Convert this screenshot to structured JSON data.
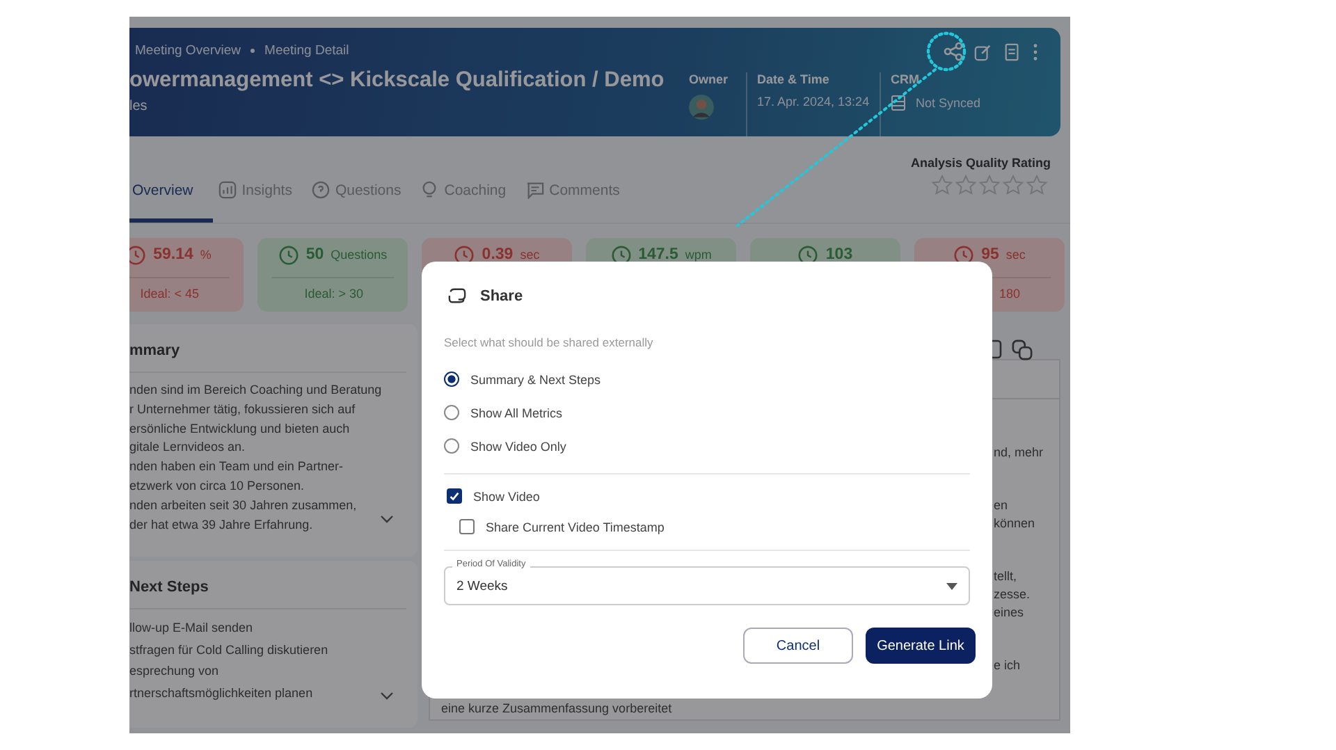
{
  "header": {
    "breadcrumb": [
      "Meeting Overview",
      "Meeting Detail"
    ],
    "title": "owermanagement <> Kickscale Qualification / Demo",
    "subtitle": "les",
    "owner_label": "Owner",
    "date_label": "Date & Time",
    "date": "17. Apr. 2024, 13:24",
    "crm_label": "CRM",
    "crm_status": "Not Synced"
  },
  "tabs": [
    {
      "label": "Overview",
      "selected": true
    },
    {
      "label": "Insights",
      "selected": false
    },
    {
      "label": "Questions",
      "selected": false
    },
    {
      "label": "Coaching",
      "selected": false
    },
    {
      "label": "Comments",
      "selected": false
    }
  ],
  "rating": {
    "label": "Analysis Quality Rating",
    "stars": 0
  },
  "metrics": [
    {
      "value": "59.14",
      "unit": "%",
      "ideal": "Ideal: < 45",
      "on_target": false
    },
    {
      "value": "50",
      "unit": "Questions",
      "ideal": "Ideal: > 30",
      "on_target": true
    },
    {
      "value": "0.39",
      "unit": "sec",
      "on_target": false
    },
    {
      "value": "147.5",
      "unit": "wpm",
      "on_target": true
    },
    {
      "value": "103",
      "on_target": true
    },
    {
      "value": "95",
      "unit": "sec",
      "ideal": "180",
      "on_target": false
    }
  ],
  "summary": {
    "title": "mmary",
    "lines": [
      "nden sind im Bereich Coaching und Beratung",
      "r Unternehmer tätig, fokussieren sich auf",
      "ersönliche Entwicklung und bieten auch",
      "gitale Lernvideos an.",
      "nden haben ein Team und ein Partner-",
      "etzwerk von circa 10 Personen.",
      "nden arbeiten seit 30 Jahren zusammen,",
      "der hat etwa 39 Jahre Erfahrung."
    ]
  },
  "next_steps": {
    "title": "Next Steps",
    "lines": [
      "llow-up E-Mail senden",
      "stfragen für Cold Calling diskutieren",
      "esprechung von",
      "rtnerschaftsmöglichkeiten planen"
    ]
  },
  "detail": {
    "paragraphs": [
      [
        "nd, mehr"
      ],
      [
        "en",
        "können"
      ],
      [
        "tellt,",
        "zesse.",
        "eines"
      ],
      [
        "e ich"
      ]
    ],
    "last_line": "eine kurze Zusammenfassung vorbereitet"
  },
  "dialog": {
    "title": "Share",
    "prompt": "Select what should be shared externally",
    "options": [
      {
        "label": "Summary & Next Steps",
        "selected": true
      },
      {
        "label": "Show All Metrics",
        "selected": false
      },
      {
        "label": "Show Video Only",
        "selected": false
      }
    ],
    "toggles": [
      {
        "label": "Show Video",
        "checked": true,
        "children": [
          {
            "label": "Share Current Video Timestamp",
            "checked": false
          }
        ]
      }
    ],
    "select": {
      "label": "Period Of Validity",
      "value": "2 Weeks"
    },
    "buttons": [
      {
        "label": "Cancel",
        "kind": "secondary"
      },
      {
        "label": "Generate Link",
        "kind": "primary"
      }
    ]
  }
}
